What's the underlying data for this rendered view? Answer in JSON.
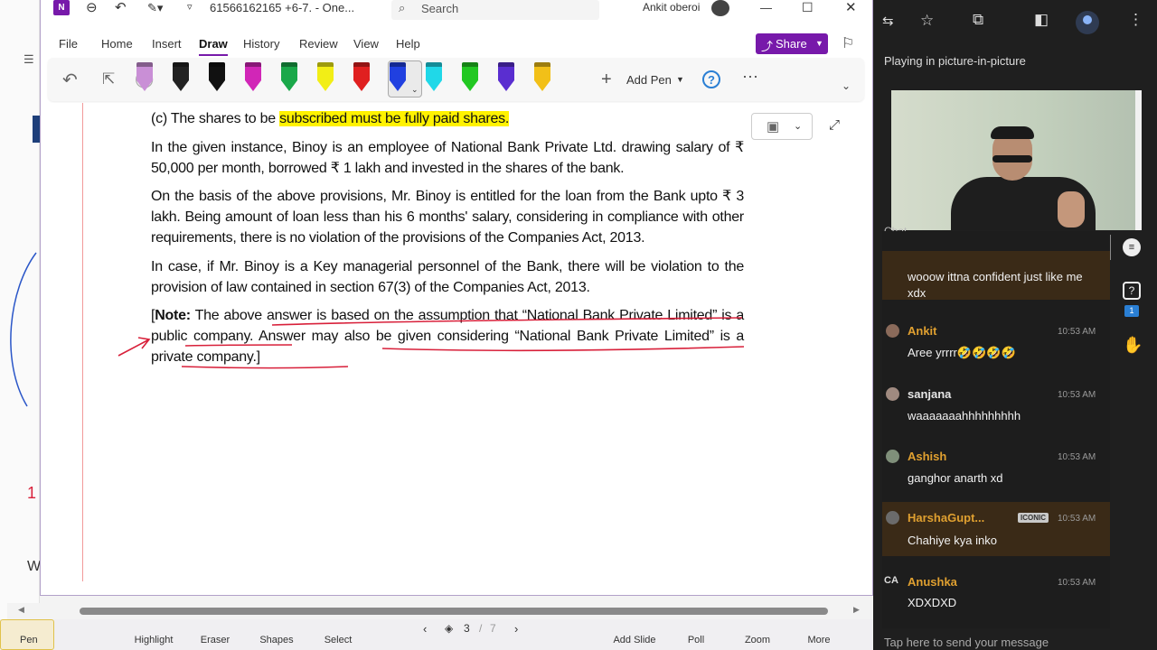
{
  "onenote": {
    "file_title": "61566162165 +6-7.  - One...",
    "search_placeholder": "Search",
    "user_name": "Ankit oberoi",
    "menus": [
      "File",
      "Home",
      "Insert",
      "Draw",
      "History",
      "Review",
      "View",
      "Help"
    ],
    "active_menu": "Draw",
    "share_label": "Share",
    "add_pen_label": "Add Pen",
    "pens": [
      {
        "color": "#c98fd6"
      },
      {
        "color": "#222222"
      },
      {
        "color": "#111111"
      },
      {
        "color": "#d126b7"
      },
      {
        "color": "#1aa84a"
      },
      {
        "color": "#f2ee16"
      },
      {
        "color": "#e02020"
      },
      {
        "color": "#2040e0"
      },
      {
        "color": "#20d8e8"
      },
      {
        "color": "#22c822"
      },
      {
        "color": "#5a2ed0"
      },
      {
        "color": "#f2c018"
      }
    ],
    "content": {
      "line_c_prefix": "(c)   The shares to be ",
      "line_c_highlight": "subscribed must be fully paid shares.",
      "para1": "In the given instance, Binoy is an employee of National Bank Private Ltd. drawing salary of ₹ 50,000 per month, borrowed ₹ 1 lakh and invested in the shares of the bank.",
      "para2": "On the basis of the above provisions, Mr. Binoy is entitled for the loan from the Bank upto ₹ 3 lakh. Being amount of loan less than his 6 months' salary, considering in compliance with other requirements, there is no violation of the provisions of the Companies Act, 2013.",
      "para3": "In case, if Mr. Binoy is a Key managerial personnel of the Bank, there will be violation to the provision of law contained in section 67(3) of the Companies Act, 2013.",
      "note_bracket": "[",
      "note_label": "Note:",
      "note_text": " The above answer is based on the assumption that “National Bank Private Limited” is a public company.  Answer may also be given considering “National Bank Private Limited” is a private company.]"
    },
    "bottom_tools": [
      "Pen",
      "Highlight",
      "Eraser",
      "Shapes",
      "Select"
    ],
    "slide_current": "3",
    "slide_sep": "/",
    "slide_total": "7",
    "right_tools": [
      "Add Slide",
      "Poll",
      "Zoom",
      "More"
    ]
  },
  "meet": {
    "pip_text": "Playing in picture-in-picture",
    "chat_label": "Chat",
    "messages": [
      {
        "name": "",
        "time": "",
        "text": "wooow ittna confident just like me xdx",
        "name_color": "#e0a030",
        "highlight": true
      },
      {
        "name": "Ankit",
        "time": "10:53 AM",
        "text": "Aree yrrrr🤣🤣🤣🤣",
        "name_color": "#e0a030",
        "highlight": false
      },
      {
        "name": "sanjana",
        "time": "10:53 AM",
        "text": "waaaaaaahhhhhhhhh",
        "name_color": "#e6e6e6",
        "highlight": false
      },
      {
        "name": "Ashish",
        "time": "10:53 AM",
        "text": "ganghor anarth xd",
        "name_color": "#e0a030",
        "highlight": false
      },
      {
        "name": "HarshaGupt...",
        "badge": "ICONIC",
        "time": "10:53 AM",
        "text": "Chahiye kya inko",
        "name_color": "#e0a030",
        "highlight": true
      },
      {
        "name": "Anushka",
        "avatar_text": "CA",
        "time": "10:53 AM",
        "text": "XDXDXD",
        "name_color": "#e0a030",
        "highlight": false
      }
    ],
    "send_placeholder": "Tap here to send your message"
  }
}
